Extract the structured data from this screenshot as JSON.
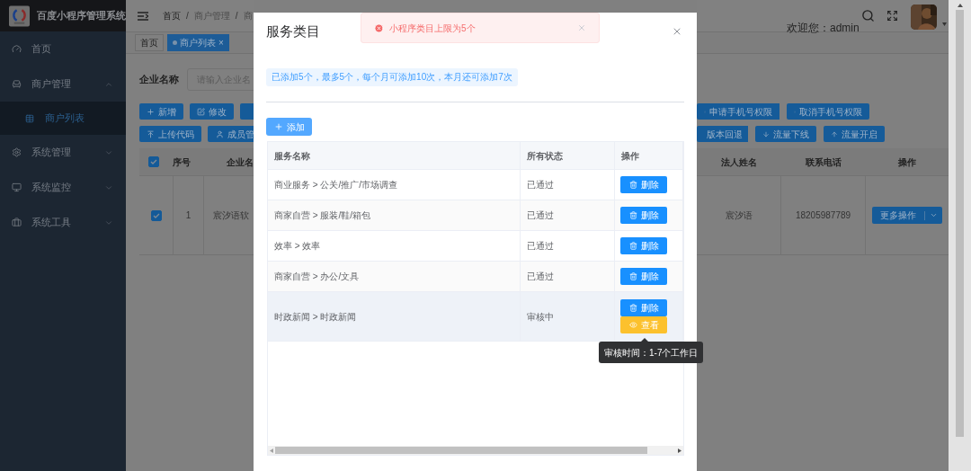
{
  "sidebar": {
    "title": "百度小程序管理系统",
    "items": [
      {
        "label": "首页"
      },
      {
        "label": "商户管理",
        "expanded": true,
        "children": [
          {
            "label": "商户列表",
            "selected": true
          }
        ]
      },
      {
        "label": "系统管理",
        "expanded": false
      },
      {
        "label": "系统监控",
        "expanded": false
      },
      {
        "label": "系统工具",
        "expanded": false
      }
    ]
  },
  "header": {
    "breadcrumb": [
      "首页",
      "商户管理",
      "商"
    ],
    "separator": "/",
    "welcome": "欢迎您：admin"
  },
  "tags": [
    {
      "label": "首页",
      "selected": false
    },
    {
      "label": "商户列表",
      "selected": true,
      "close": "×"
    }
  ],
  "search": {
    "label": "企业名称",
    "placeholder": "请输入企业名"
  },
  "toolbar_left": [
    [
      {
        "kind": "labeled",
        "label": "新增"
      },
      {
        "kind": "labeled",
        "label": "修改"
      },
      {
        "kind": "clipped"
      }
    ],
    [
      {
        "kind": "labeled",
        "label": "上传代码"
      },
      {
        "kind": "labeled",
        "label": "成员管"
      }
    ]
  ],
  "toolbar_right": [
    [
      "申请手机号权限",
      "取消手机号权限"
    ],
    [
      "版本回退",
      "流量下线",
      "流量开启"
    ]
  ],
  "merchant_table": {
    "all_checked": true,
    "columns_left": [
      "序号",
      "企业名"
    ],
    "columns_right": [
      "法人姓名",
      "联系电话",
      "操作"
    ],
    "rows": [
      {
        "checked": true,
        "index": "1",
        "company": "宸汐语软",
        "legal_person": "宸汐语",
        "phone": "18205987789",
        "action": "更多操作"
      }
    ]
  },
  "dialog": {
    "title": "服务类目",
    "toast": {
      "kind": "error",
      "message": "小程序类目上限为5个"
    },
    "info": "已添加5个，最多5个，每个月可添加10次，本月还可添加7次",
    "add_button": "添加",
    "columns": [
      "服务名称",
      "所有状态",
      "操作"
    ],
    "rows": [
      {
        "name": "商业服务 > 公关/推广/市场调查",
        "status": "已通过",
        "hovered": false,
        "actions": [
          {
            "kind": "delete",
            "label": "删除"
          }
        ]
      },
      {
        "name": "商家自营 > 服装/鞋/箱包",
        "status": "已通过",
        "hovered": false,
        "actions": [
          {
            "kind": "delete",
            "label": "删除"
          }
        ]
      },
      {
        "name": "效率 > 效率",
        "status": "已通过",
        "hovered": false,
        "actions": [
          {
            "kind": "delete",
            "label": "删除"
          }
        ]
      },
      {
        "name": "商家自营 > 办公/文具",
        "status": "已通过",
        "hovered": false,
        "actions": [
          {
            "kind": "delete",
            "label": "删除"
          }
        ]
      },
      {
        "name": "时政新闻 > 时政新闻",
        "status": "审核中",
        "hovered": true,
        "actions": [
          {
            "kind": "delete",
            "label": "删除"
          },
          {
            "kind": "view",
            "label": "查看",
            "tooltip": "审核时间：1-7个工作日"
          }
        ]
      }
    ]
  }
}
